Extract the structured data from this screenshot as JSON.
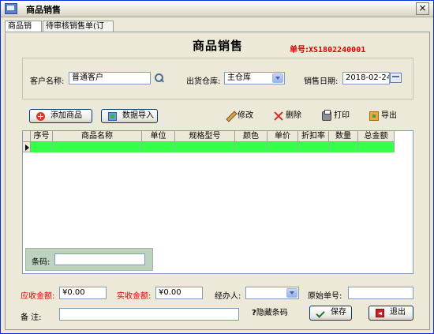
{
  "window": {
    "title": "商品销售"
  },
  "tabs": [
    {
      "label": "商品销售",
      "active": true
    },
    {
      "label": "待审核销售单(订单)",
      "active": false
    }
  ],
  "form": {
    "title": "商品销售",
    "order_label": "单号:",
    "order_number": "XS1802240001"
  },
  "header": {
    "customer_label": "客户名称:",
    "customer_value": "普通客户",
    "warehouse_label": "出货仓库:",
    "warehouse_value": "主仓库",
    "date_label": "销售日期:",
    "date_value": "2018-02-24"
  },
  "toolbar": {
    "add_product": "添加商品",
    "import_data": "数据导入",
    "edit": "修改",
    "delete": "删除",
    "print": "打印",
    "export": "导出"
  },
  "grid": {
    "columns": [
      "序号",
      "商品名称",
      "单位",
      "规格型号",
      "颜色",
      "单价",
      "折扣率",
      "数量",
      "总金额"
    ],
    "selected_row_color": "#35FF4A"
  },
  "barcode": {
    "label": "条码:",
    "value": ""
  },
  "footer": {
    "receivable_label": "应收金额:",
    "receivable_value": "¥0.00",
    "received_label": "实收金额:",
    "received_value": "¥0.00",
    "handler_label": "经办人:",
    "handler_value": "",
    "original_no_label": "原始单号:",
    "original_no_value": "",
    "remark_label": "备    注:",
    "remark_value": "",
    "hide_barcode_symbol": "?",
    "hide_barcode_label": "隐藏条码",
    "save": "保存",
    "exit": "退出"
  },
  "colors": {
    "accent_red": "#E00000",
    "row_highlight": "#35FF4A",
    "barcode_panel": "#BDD3C0"
  }
}
